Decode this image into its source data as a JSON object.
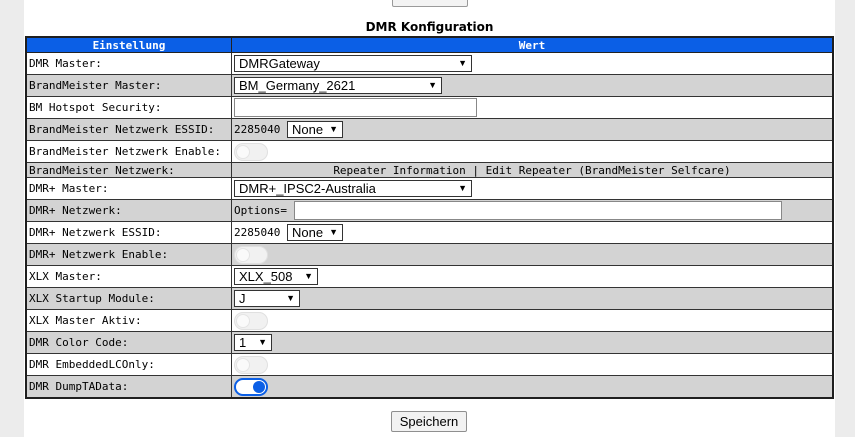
{
  "page_title": "DMR Konfiguration",
  "table": {
    "header_setting": "Einstellung",
    "header_value": "Wert"
  },
  "rows": {
    "dmr_master": {
      "label": "DMR Master:",
      "value": "DMRGateway"
    },
    "bm_master": {
      "label": "BrandMeister Master:",
      "value": "BM_Germany_2621"
    },
    "bm_hotspot_security": {
      "label": "BM Hotspot Security:",
      "value": ""
    },
    "bm_essid": {
      "label": "BrandMeister Netzwerk ESSID:",
      "prefix": "2285040",
      "value": "None"
    },
    "bm_enable": {
      "label": "BrandMeister Netzwerk Enable:",
      "on": false
    },
    "bm_network": {
      "label": "BrandMeister Netzwerk:",
      "link_repeater_info": "Repeater Information",
      "separator": "|",
      "link_edit_repeater": "Edit Repeater (BrandMeister Selfcare)"
    },
    "dmrplus_master": {
      "label": "DMR+ Master:",
      "value": "DMR+_IPSC2-Australia"
    },
    "dmrplus_network": {
      "label": "DMR+ Netzwerk:",
      "prefix": "Options=",
      "value": ""
    },
    "dmrplus_essid": {
      "label": "DMR+ Netzwerk ESSID:",
      "prefix": "2285040",
      "value": "None"
    },
    "dmrplus_enable": {
      "label": "DMR+ Netzwerk Enable:",
      "on": false
    },
    "xlx_master": {
      "label": "XLX Master:",
      "value": "XLX_508"
    },
    "xlx_startup_module": {
      "label": "XLX Startup Module:",
      "value": "J"
    },
    "xlx_master_active": {
      "label": "XLX Master Aktiv:",
      "on": false
    },
    "dmr_color_code": {
      "label": "DMR Color Code:",
      "value": "1"
    },
    "dmr_embedded_lc_only": {
      "label": "DMR EmbeddedLCOnly:",
      "on": false
    },
    "dmr_dump_ta_data": {
      "label": "DMR DumpTAData:",
      "on": true
    }
  },
  "save_label": "Speichern",
  "colors": {
    "header": "#0b5fe6",
    "row_alt": "#d3d3d3"
  }
}
